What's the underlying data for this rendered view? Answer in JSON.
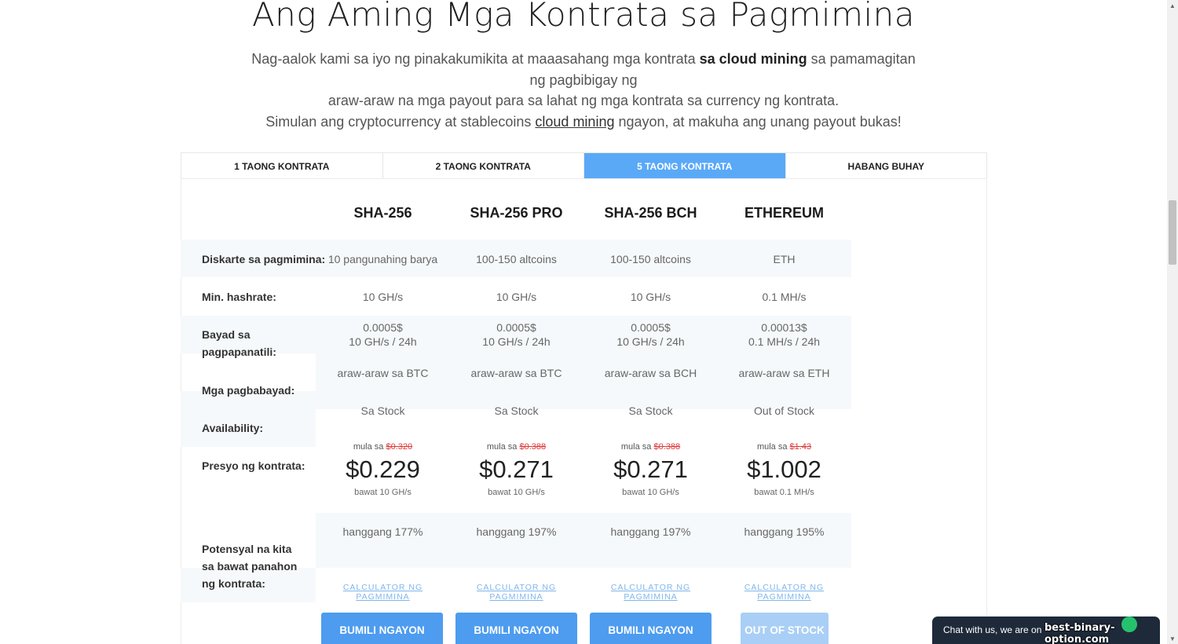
{
  "header": {
    "title": "Ang Aming Mga Kontrata sa Pagmimina",
    "intro_pre": "Nag-aalok kami sa iyo ng pinakakumikita at maaasahang mga kontrata ",
    "intro_bold": "sa cloud mining",
    "intro_post": " sa pamamagitan ng pagbibigay ng",
    "intro_line2": "araw-araw na mga payout para sa lahat ng mga kontrata sa currency ng kontrata.",
    "intro_line3_pre": "Simulan ang cryptocurrency at stablecoins ",
    "intro_link": "cloud mining",
    "intro_line3_post": " ngayon, at makuha ang unang payout bukas!"
  },
  "tabs": [
    {
      "label": "1 TAONG KONTRATA",
      "active": false
    },
    {
      "label": "2 TAONG KONTRATA",
      "active": false
    },
    {
      "label": "5 TAONG KONTRATA",
      "active": true
    },
    {
      "label": "HABANG BUHAY",
      "active": false
    }
  ],
  "row_labels": {
    "strategy": "Diskarte sa pagmimina:",
    "hashrate": "Min. hashrate:",
    "maintenance": "Bayad sa pagpapanatili:",
    "payouts": "Mga pagbabayad:",
    "availability": "Availability:",
    "price": "Presyo ng kontrata:",
    "profit": "Potensyal na kita sa bawat panahon ng kontrata:"
  },
  "price_from_label": "mula sa",
  "plans": [
    {
      "name": "SHA-256",
      "strategy": "10 pangunahing barya",
      "hashrate": "10 GH/s",
      "fee_amount": "0.0005$",
      "fee_unit": "10 GH/s / 24h",
      "payout": "araw-araw sa BTC",
      "availability": "Sa Stock",
      "old_price": "$0.320",
      "price": "$0.229",
      "per_unit": "bawat 10 GH/s",
      "profit": "hanggang 177%",
      "calc_link": "CALCULATOR NG PAGMIMINA",
      "button": "BUMILI NGAYON",
      "in_stock": true
    },
    {
      "name": "SHA-256 PRO",
      "strategy": "100-150 altcoins",
      "hashrate": "10 GH/s",
      "fee_amount": "0.0005$",
      "fee_unit": "10 GH/s / 24h",
      "payout": "araw-araw sa BTC",
      "availability": "Sa Stock",
      "old_price": "$0.388",
      "price": "$0.271",
      "per_unit": "bawat 10 GH/s",
      "profit": "hanggang 197%",
      "calc_link": "CALCULATOR NG PAGMIMINA",
      "button": "BUMILI NGAYON",
      "in_stock": true
    },
    {
      "name": "SHA-256 BCH",
      "strategy": "100-150 altcoins",
      "hashrate": "10 GH/s",
      "fee_amount": "0.0005$",
      "fee_unit": "10 GH/s / 24h",
      "payout": "araw-araw sa BCH",
      "availability": "Sa Stock",
      "old_price": "$0.388",
      "price": "$0.271",
      "per_unit": "bawat 10 GH/s",
      "profit": "hanggang 197%",
      "calc_link": "CALCULATOR NG PAGMIMINA",
      "button": "BUMILI NGAYON",
      "in_stock": true
    },
    {
      "name": "ETHEREUM",
      "strategy": "ETH",
      "hashrate": "0.1 MH/s",
      "fee_amount": "0.00013$",
      "fee_unit": "0.1 MH/s / 24h",
      "payout": "araw-araw sa ETH",
      "availability": "Out of Stock",
      "old_price": "$1.43",
      "price": "$1.002",
      "per_unit": "bawat 0.1 MH/s",
      "profit": "hanggang 195%",
      "calc_link": "CALCULATOR NG PAGMIMINA",
      "button": "OUT OF STOCK",
      "in_stock": false
    }
  ],
  "chat": {
    "text": "Chat with us, we are on"
  },
  "watermark": "best-binary-option.com",
  "colors": {
    "accent": "#5aa9f7",
    "button": "#4d9cf0",
    "strike": "#e03a3a"
  }
}
